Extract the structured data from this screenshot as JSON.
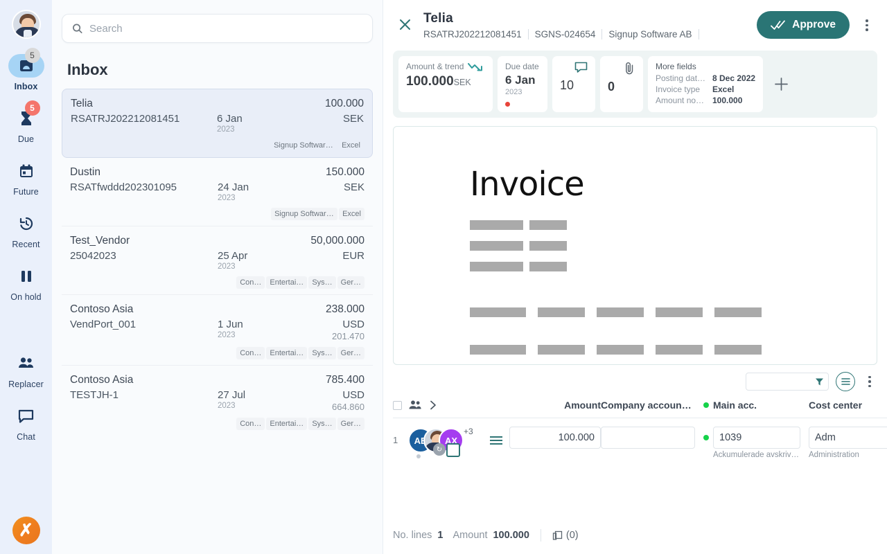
{
  "rail": {
    "avatar_name": "user-avatar",
    "items": [
      {
        "label": "Inbox",
        "icon": "inbox-icon",
        "badge": "5",
        "badge_style": "grey",
        "active": true
      },
      {
        "label": "Due",
        "icon": "hourglass-icon",
        "badge": "5",
        "badge_style": "red",
        "active": false
      },
      {
        "label": "Future",
        "icon": "calendar-icon",
        "badge": "",
        "badge_style": "",
        "active": false
      },
      {
        "label": "Recent",
        "icon": "clock-history-icon",
        "badge": "",
        "badge_style": "",
        "active": false
      },
      {
        "label": "On hold",
        "icon": "pause-icon",
        "badge": "",
        "badge_style": "",
        "active": false
      },
      {
        "label": "Replacer",
        "icon": "people-icon",
        "badge": "",
        "badge_style": "",
        "active": false
      },
      {
        "label": "Chat",
        "icon": "chat-icon",
        "badge": "",
        "badge_style": "",
        "active": false
      }
    ],
    "logo_glyph": "✗"
  },
  "search": {
    "placeholder": "Search",
    "value": "",
    "icon": "search-icon"
  },
  "inbox": {
    "title": "Inbox",
    "rows": [
      {
        "vendor": "Telia",
        "reference": "RSATRJ202212081451",
        "date": "6 Jan",
        "year": "2023",
        "amount": "100.000",
        "currency": "SEK",
        "secondary": "",
        "tags": [
          "Signup Software AB",
          "Excel"
        ],
        "selected": true
      },
      {
        "vendor": "Dustin",
        "reference": "RSATfwddd202301095",
        "date": "24 Jan",
        "year": "2023",
        "amount": "150.000",
        "currency": "SEK",
        "secondary": "",
        "tags": [
          "Signup Software AB",
          "Excel"
        ],
        "selected": false
      },
      {
        "vendor": "Test_Vendor",
        "reference": "25042023",
        "date": "25 Apr",
        "year": "2023",
        "amount": "50,000.000",
        "currency": "EUR",
        "secondary": "",
        "tags": [
          "Con…",
          "Entertai…",
          "Sys…",
          "Ger…"
        ],
        "selected": false
      },
      {
        "vendor": "Contoso Asia",
        "reference": "VendPort_001",
        "date": "1 Jun",
        "year": "2023",
        "amount": "238.000",
        "currency": "USD",
        "secondary": "201.470",
        "tags": [
          "Con…",
          "Entertai…",
          "Sys…",
          "Ger…"
        ],
        "selected": false
      },
      {
        "vendor": "Contoso Asia",
        "reference": "TESTJH-1",
        "date": "27 Jul",
        "year": "2023",
        "amount": "785.400",
        "currency": "USD",
        "secondary": "664.860",
        "tags": [
          "Con…",
          "Entertai…",
          "Sys…",
          "Ger…"
        ],
        "selected": false
      }
    ]
  },
  "detail": {
    "close_icon": "close-icon",
    "title": "Telia",
    "breadcrumb": [
      "RSATRJ202212081451",
      "SGNS-024654",
      "Signup Software AB"
    ],
    "approve_label": "Approve",
    "approve_icon": "double-check-icon",
    "approve_color": "#2a7575",
    "menu_icon": "kebab-menu-icon",
    "cards": {
      "amount": {
        "label": "Amount & trend",
        "trend_icon": "trend-down-icon",
        "value": "100.000",
        "currency": "SEK"
      },
      "due": {
        "label": "Due date",
        "day": "6 Jan",
        "year": "2023",
        "status_color": "#e8443a"
      },
      "comments": {
        "icon": "comment-icon",
        "count": "10"
      },
      "attachments": {
        "icon": "paperclip-icon",
        "count": "0"
      },
      "more": {
        "title": "More fields",
        "fields": [
          {
            "key": "Posting dat…",
            "value": "8 Dec 2022"
          },
          {
            "key": "Invoice type",
            "value": "Excel"
          },
          {
            "key": "Amount no…",
            "value": "100.000"
          }
        ]
      },
      "add_icon": "plus-icon"
    },
    "document": {
      "heading": "Invoice"
    },
    "lines_toolbar": {
      "filter_value": "",
      "filter_icon": "funnel-icon",
      "list-view_icon": "list-view-icon",
      "menu_icon": "kebab-menu-icon"
    },
    "table": {
      "headers": [
        "",
        "",
        "Amount",
        "Company accoun…",
        "Main acc.",
        "Cost center"
      ],
      "header_amount": "Amount",
      "header_company": "Company accoun…",
      "header_main": "Main acc.",
      "header_cost": "Cost center",
      "assign_icon": "people-icon",
      "expand_icon": "chevron-right-icon",
      "rows": [
        {
          "number": "1",
          "avatars": [
            {
              "initials": "AB",
              "color": "#1b5f9e"
            },
            {
              "initials": "",
              "color": "#cfd6df"
            },
            {
              "initials": "AX",
              "color": "#a53df0"
            }
          ],
          "avatar_overflow": "+3",
          "amount": "100.000",
          "company_account": "",
          "main_account": "1039",
          "main_account_caption": "Ackumulerade avskriv…",
          "cost_center": "Adm",
          "cost_center_caption": "Administration"
        }
      ]
    },
    "footer": {
      "lines_label": "No. lines",
      "lines_value": "1",
      "amount_label": "Amount",
      "amount_value": "100.000",
      "copies_icon": "copy-icon",
      "copies_value": "(0)"
    }
  }
}
